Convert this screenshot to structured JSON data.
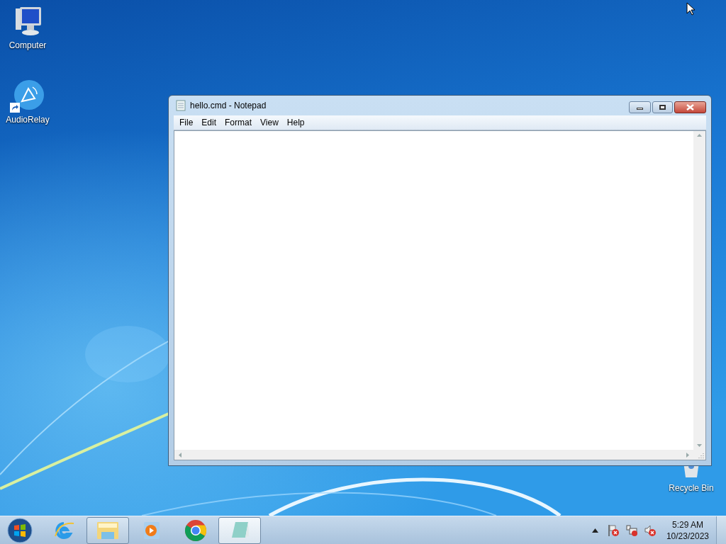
{
  "desktop_icons": [
    {
      "kind": "computer",
      "label": "Computer"
    },
    {
      "kind": "audiorelay",
      "label": "AudioRelay",
      "shortcut": true
    }
  ],
  "recycle_bin": {
    "label": "Recycle Bin"
  },
  "window": {
    "title": "hello.cmd - Notepad",
    "menu": [
      "File",
      "Edit",
      "Format",
      "View",
      "Help"
    ]
  },
  "taskbar": {
    "items": [
      {
        "kind": "ie",
        "running": false,
        "selected": false
      },
      {
        "kind": "explorer",
        "running": true,
        "selected": false
      },
      {
        "kind": "media",
        "running": false,
        "selected": false
      },
      {
        "kind": "chrome",
        "running": false,
        "selected": false
      },
      {
        "kind": "notepad",
        "running": true,
        "selected": true
      }
    ],
    "tray": {
      "time": "5:29 AM",
      "date": "10/23/2023"
    }
  }
}
